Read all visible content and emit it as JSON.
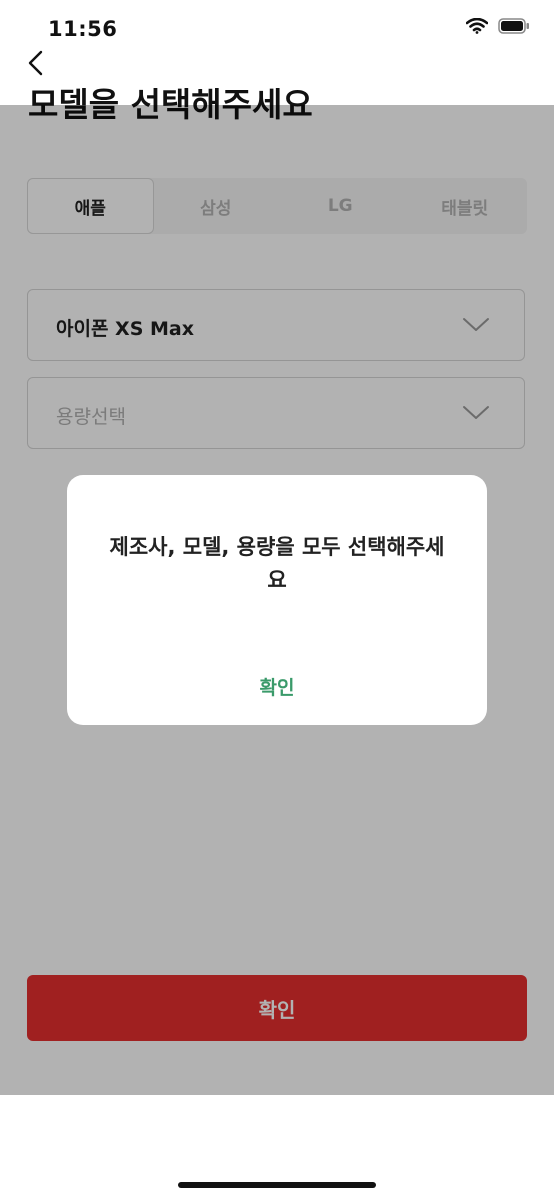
{
  "status_bar": {
    "time": "11:56"
  },
  "header": {
    "title": "모델을 선택해주세요"
  },
  "tabs": [
    {
      "label": "애플",
      "active": true
    },
    {
      "label": "삼성",
      "active": false
    },
    {
      "label": "LG",
      "active": false
    },
    {
      "label": "태블릿",
      "active": false
    }
  ],
  "model_select": {
    "value": "아이폰 XS Max"
  },
  "capacity_select": {
    "placeholder": "용량선택"
  },
  "confirm_button": {
    "label": "확인",
    "color": "#e62e2e"
  },
  "dialog": {
    "message_line1": "제조사, 모델, 용량을 모두 선택해주세",
    "message_line2": "요",
    "ok_label": "확인",
    "ok_color": "#3a9a6a"
  },
  "icons": [
    "back-icon",
    "wifi-icon",
    "battery-icon",
    "chevron-down-icon"
  ]
}
